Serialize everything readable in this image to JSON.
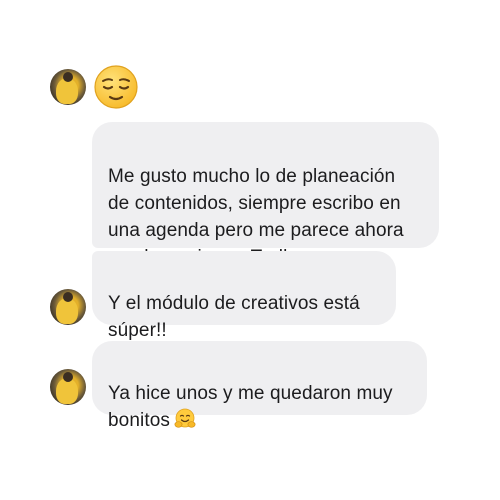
{
  "messages": [
    {
      "text": "Me gusto mucho lo de planeación\nde contenidos, siempre escribo en\nuna agenda pero me parece ahora\nmucho mejor en Trello",
      "emoji": ""
    },
    {
      "text": "Y el módulo de creativos está\nsúper!!",
      "emoji": ""
    },
    {
      "text": "Ya hice unos y me quedaron muy\nbonitos",
      "emoji": "hugging-face-icon"
    }
  ],
  "top_reaction_icon": "relieved-face-icon",
  "colors": {
    "bubble_bg": "#efeff1",
    "text": "#1c1c1e",
    "emoji_yellow": "#ffcb3d",
    "emoji_outline": "#e0a21f"
  }
}
